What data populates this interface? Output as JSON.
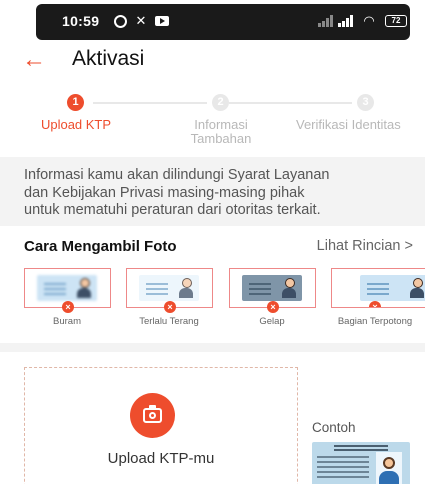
{
  "status_bar": {
    "time": "10:59",
    "battery": "72",
    "icons": [
      "whatsapp-icon",
      "x-icon",
      "youtube-icon",
      "signal-icon",
      "signal-icon",
      "wifi-icon",
      "battery-icon"
    ]
  },
  "header": {
    "back_icon": "arrow-left-icon",
    "title": "Aktivasi"
  },
  "stepper": {
    "steps": [
      {
        "number": "1",
        "label": "Upload KTP",
        "active": true
      },
      {
        "number": "2",
        "label": "Informasi Tambahan",
        "active": false
      },
      {
        "number": "3",
        "label": "Verifikasi Identitas",
        "active": false
      }
    ]
  },
  "info": {
    "line1": "Informasi kamu akan dilindungi Syarat Layanan",
    "line2": "dan Kebijakan Privasi masing-masing pihak",
    "line3": "untuk mematuhi peraturan dari otoritas terkait."
  },
  "photo_guide": {
    "title": "Cara Mengambil Foto",
    "link": "Lihat Rincian >",
    "samples": [
      {
        "label": "Buram"
      },
      {
        "label": "Terlalu Terang"
      },
      {
        "label": "Gelap"
      },
      {
        "label": "Bagian Terpotong"
      }
    ],
    "mark": "×"
  },
  "upload": {
    "label": "Upload KTP-mu",
    "example_label": "Contoh"
  },
  "colors": {
    "accent": "#ee4d2d",
    "muted": "#b8b8b8",
    "band": "#f3f3f3"
  }
}
